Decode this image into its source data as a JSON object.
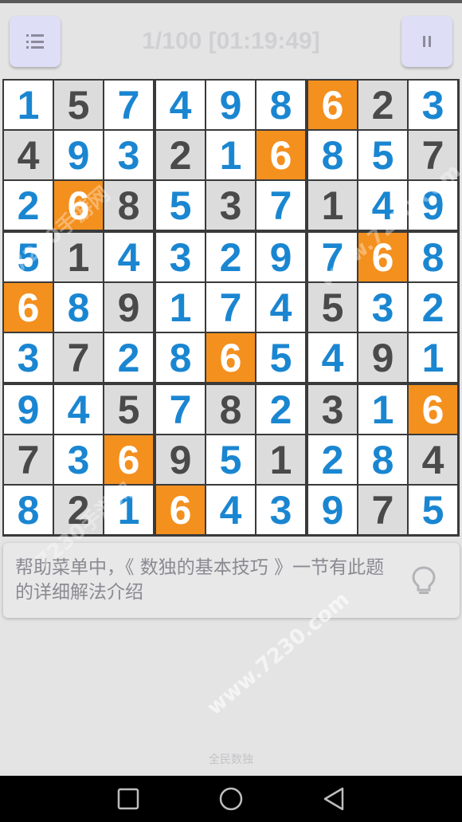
{
  "header": {
    "status_text": "1/100 [01:19:49]",
    "menu_button": "menu-icon",
    "pause_button": "pause-icon"
  },
  "board": {
    "rows": [
      [
        1,
        5,
        7,
        4,
        9,
        8,
        6,
        2,
        3
      ],
      [
        4,
        9,
        3,
        2,
        1,
        6,
        8,
        5,
        7
      ],
      [
        2,
        6,
        8,
        5,
        3,
        7,
        1,
        4,
        9
      ],
      [
        5,
        1,
        4,
        3,
        2,
        9,
        7,
        6,
        8
      ],
      [
        6,
        8,
        9,
        1,
        7,
        4,
        5,
        3,
        2
      ],
      [
        3,
        7,
        2,
        8,
        6,
        5,
        4,
        9,
        1
      ],
      [
        9,
        4,
        5,
        7,
        8,
        2,
        3,
        1,
        6
      ],
      [
        7,
        3,
        6,
        9,
        5,
        1,
        2,
        8,
        4
      ],
      [
        8,
        2,
        1,
        6,
        4,
        3,
        9,
        7,
        5
      ]
    ],
    "given": [
      [
        0,
        1,
        0,
        0,
        0,
        0,
        0,
        1,
        0
      ],
      [
        1,
        0,
        0,
        1,
        0,
        0,
        0,
        0,
        1
      ],
      [
        0,
        0,
        1,
        0,
        1,
        0,
        1,
        0,
        0
      ],
      [
        0,
        1,
        0,
        0,
        0,
        0,
        0,
        0,
        0
      ],
      [
        0,
        0,
        1,
        0,
        0,
        0,
        1,
        0,
        0
      ],
      [
        0,
        1,
        0,
        0,
        0,
        0,
        0,
        1,
        0
      ],
      [
        0,
        0,
        1,
        0,
        1,
        0,
        1,
        0,
        0
      ],
      [
        1,
        0,
        0,
        1,
        0,
        1,
        0,
        0,
        1
      ],
      [
        0,
        1,
        0,
        0,
        0,
        0,
        0,
        1,
        0
      ]
    ],
    "highlight_digit": 6,
    "colors": {
      "entered_digit": "#1a86d1",
      "given_digit": "#4a4a4a",
      "highlight_bg": "#f4901e",
      "given_bg": "#dcdcdc",
      "empty_bg": "#ffffff"
    }
  },
  "hint": {
    "text": "帮助菜单中，《 数独的基本技巧 》一节有此题的详细解法介绍",
    "icon": "lightbulb-icon"
  },
  "footer": {
    "label": "全民数独"
  },
  "watermark": {
    "text_a": "7230手游网",
    "text_b": "www.7230.com"
  },
  "navbar": {
    "recent_icon": "square-icon",
    "home_icon": "circle-icon",
    "back_icon": "triangle-back-icon"
  }
}
